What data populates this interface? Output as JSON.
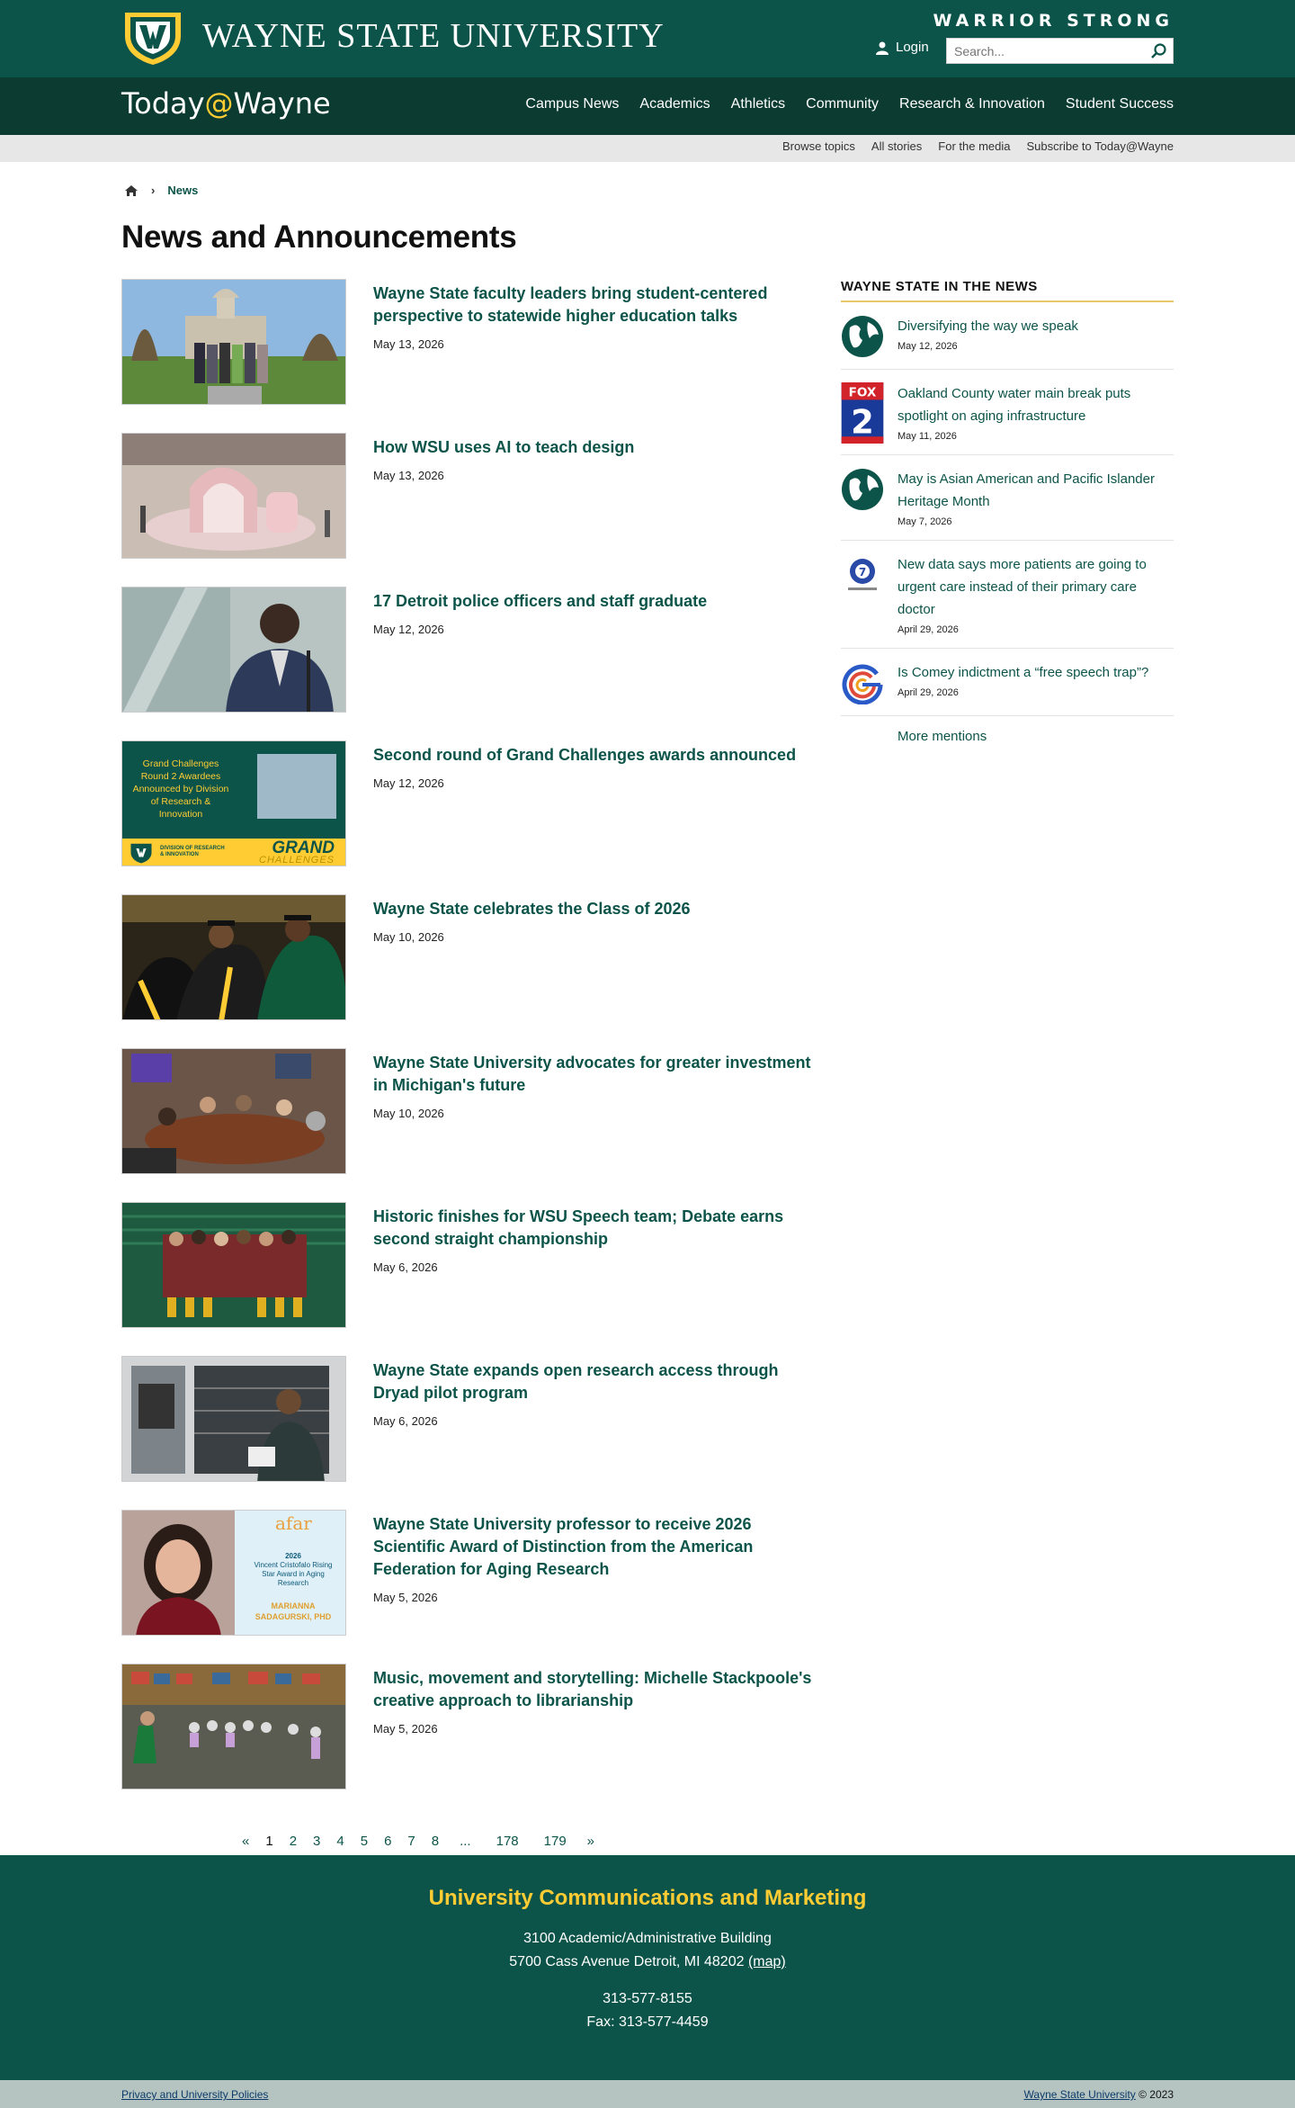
{
  "header": {
    "university_name": "WAYNE STATE UNIVERSITY",
    "tagline": "WARRIOR STRONG",
    "login_label": "Login",
    "search_placeholder": "Search..."
  },
  "site": {
    "brand_left": "Today",
    "brand_at": "@",
    "brand_right": "Wayne"
  },
  "main_nav": [
    "Campus News",
    "Academics",
    "Athletics",
    "Community",
    "Research & Innovation",
    "Student Success"
  ],
  "sub_nav": [
    "Browse topics",
    "All stories",
    "For the media",
    "Subscribe to Today@Wayne"
  ],
  "breadcrumb": {
    "current": "News"
  },
  "page_title": "News and Announcements",
  "stories": [
    {
      "title": "Wayne State faculty leaders bring student-centered perspective to statewide higher education talks",
      "date": "May 13, 2026"
    },
    {
      "title": "How WSU uses AI to teach design",
      "date": "May 13, 2026"
    },
    {
      "title": "17 Detroit police officers and staff graduate",
      "date": "May 12, 2026"
    },
    {
      "title": "Second round of Grand Challenges awards announced",
      "date": "May 12, 2026"
    },
    {
      "title": "Wayne State celebrates the Class of 2026",
      "date": "May 10, 2026"
    },
    {
      "title": "Wayne State University advocates for greater investment in Michigan's future",
      "date": "May 10, 2026"
    },
    {
      "title": "Historic finishes for WSU Speech team; Debate earns second straight championship",
      "date": "May 6, 2026"
    },
    {
      "title": "Wayne State expands open research access through Dryad pilot program",
      "date": "May 6, 2026"
    },
    {
      "title": "Wayne State University professor to receive 2026 Scientific Award of Distinction from the American Federation for Aging Research",
      "date": "May 5, 2026"
    },
    {
      "title": "Music, movement and storytelling: Michelle Stackpoole's creative approach to librarianship",
      "date": "May 5, 2026"
    }
  ],
  "grand_challenges_thumb": {
    "text": "Grand Challenges Round 2 Awardees Announced by Division of Research & Innovation",
    "dept": "DIVISION OF RESEARCH & INNOVATION",
    "big1": "GRAND",
    "big2": "CHALLENGES"
  },
  "afar_thumb": {
    "logo": "afar",
    "year": "2026",
    "award": "Vincent Cristofalo Rising Star Award in Aging Research",
    "name": "MARIANNA SADAGURSKI, PHD"
  },
  "sidebar": {
    "heading": "WAYNE STATE IN THE NEWS",
    "mentions": [
      {
        "icon": "globe-icon",
        "title": "Diversifying the way we speak",
        "date": "May 12, 2026"
      },
      {
        "icon": "fox2-logo-icon",
        "title": "Oakland County water main break puts spotlight on aging infrastructure",
        "date": "May 11, 2026"
      },
      {
        "icon": "globe-icon",
        "title": "May is Asian American and Pacific Islander Heritage Month",
        "date": "May 7, 2026"
      },
      {
        "icon": "wxyz-logo-icon",
        "title": "New data says more patients are going to urgent care instead of their primary care doctor",
        "date": "April 29, 2026"
      },
      {
        "icon": "g-logo-icon",
        "title": "Is Comey indictment a “free speech trap”?",
        "date": "April 29, 2026"
      }
    ],
    "more_label": "More mentions"
  },
  "pagination": [
    "«",
    "1",
    "2",
    "3",
    "4",
    "5",
    "6",
    "7",
    "8",
    "...",
    "178",
    "179",
    "»"
  ],
  "footer": {
    "heading": "University Communications and Marketing",
    "address1": "3100 Academic/Administrative Building",
    "address2": "5700 Cass Avenue Detroit, MI 48202 ",
    "map_label": "(map)",
    "phone": "313-577-8155",
    "fax": "Fax: 313-577-4459",
    "privacy_label": "Privacy and University Policies",
    "wsu_link": "Wayne State University",
    "copyright": " © 2023"
  },
  "colors": {
    "brand_green": "#0c5449",
    "dark_green": "#0b3b31",
    "gold": "#ffcc33"
  }
}
